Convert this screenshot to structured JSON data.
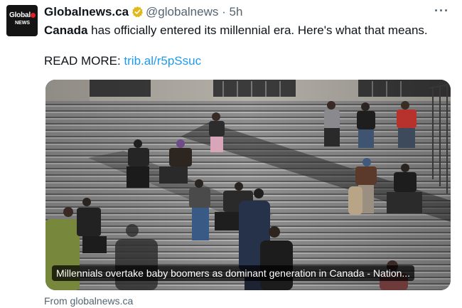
{
  "post": {
    "display_name": "Globalnews.ca",
    "handle": "@globalnews",
    "separator": "·",
    "time": "5h",
    "text_bold": "Canada",
    "text_rest": " has officially entered its millennial era. Here's what that means.",
    "read_more_label": "READ MORE: ",
    "read_more_link": "trib.al/r5pSsuc"
  },
  "avatar": {
    "logo_text": "Global",
    "logo_sub": "NEWS"
  },
  "card": {
    "caption": "Millennials overtake baby boomers as dominant generation in Canada - Nation...",
    "source": "From globalnews.ca"
  },
  "icons": {
    "verified": "verified-badge-icon",
    "more": "more-options-icon"
  },
  "colors": {
    "link": "#1d9bf0",
    "verified": "#e2b719",
    "muted": "#536471",
    "logo_red": "#e41f26"
  }
}
